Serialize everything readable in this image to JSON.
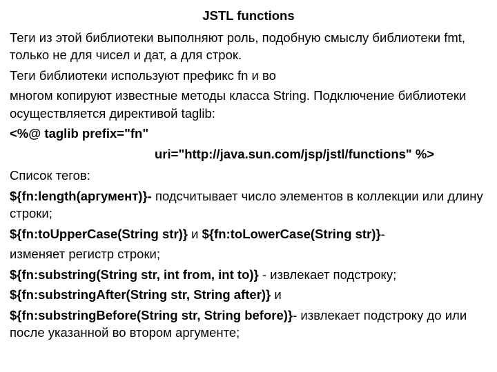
{
  "title": "JSTL functions",
  "p1": "Теги из этой библиотеки выполняют роль, подобную смыслу библиотеки fmt, только не для чисел и дат, а для строк.",
  "p2": "Теги библиотеки используют префикс fn и во",
  "p3": "многом копируют известные методы класса String. Подключение библиотеки осуществляется директивой taglib:",
  "taglib_line1": "<%@ taglib prefix=\"fn\"",
  "taglib_line2": "uri=\"http://java.sun.com/jsp/jstl/functions\" %>",
  "list_label": "Список тегов:",
  "fn_length_bold": "${fn:length(аргумент)}-",
  "fn_length_rest": " подсчитывает число элементов в коллекции или длину строки;",
  "fn_upper_bold": "${fn:toUpperCase(String str)}",
  "fn_and": " и ",
  "fn_lower_bold": "${fn:toLowerCase(String str)}",
  "fn_dash": "-",
  "fn_case_rest": "изменяет регистр строки;",
  "fn_substring_bold": "${fn:substring(String str, int from, int to)}",
  "fn_substring_rest": " - извлекает подстроку;",
  "fn_after_bold": "${fn:substringAfter(String str, String after)}",
  "fn_after_rest": " и",
  "fn_before_bold": "${fn:substringBefore(String str, String before)}",
  "fn_before_rest": "- извлекает подстроку до или после указанной во втором аргументе;"
}
